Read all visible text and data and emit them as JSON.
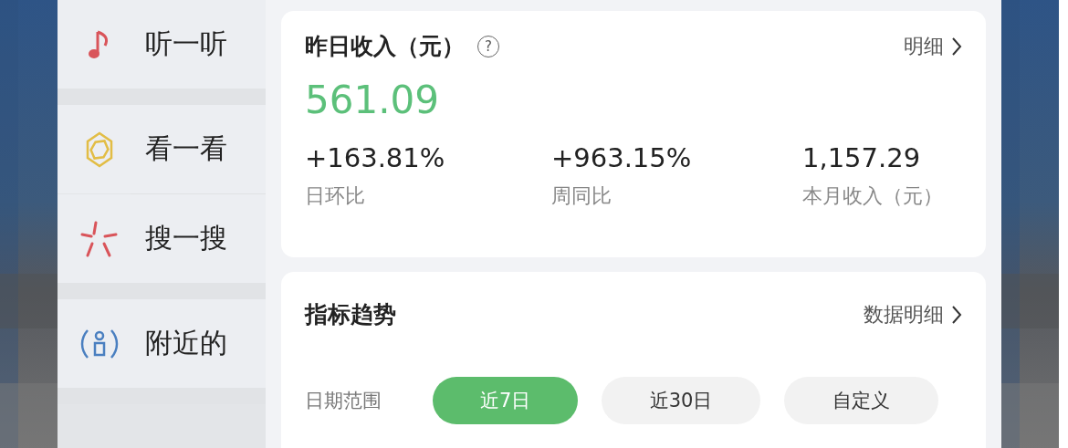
{
  "menu": {
    "items": [
      {
        "label": "听一听"
      },
      {
        "label": "看一看"
      },
      {
        "label": "搜一搜"
      },
      {
        "label": "附近的"
      }
    ]
  },
  "income_card": {
    "title": "昨日收入（元）",
    "help": "?",
    "link": "明细",
    "amount": "561.09",
    "stats": [
      {
        "value": "+163.81%",
        "label": "日环比"
      },
      {
        "value": "+963.15%",
        "label": "周同比"
      },
      {
        "value": "1,157.29",
        "label": "本月收入（元）"
      }
    ]
  },
  "trend_card": {
    "title": "指标趋势",
    "link": "数据明细",
    "range_label": "日期范围",
    "ranges": [
      {
        "label": "近7日",
        "selected": true
      },
      {
        "label": "近30日",
        "selected": false
      },
      {
        "label": "自定义",
        "selected": false
      }
    ]
  }
}
